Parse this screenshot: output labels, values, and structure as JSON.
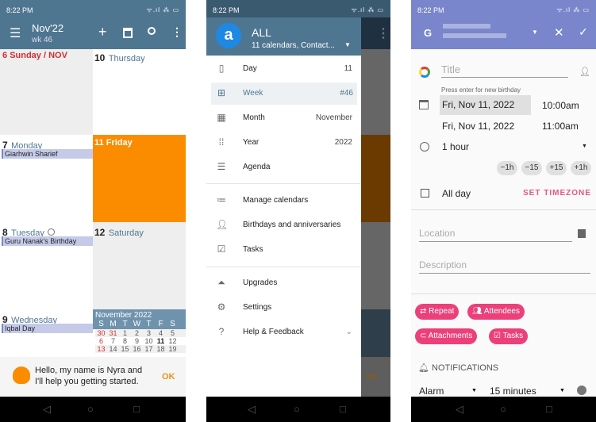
{
  "status": {
    "time": "8:22 PM",
    "icons": "wifi signal battery 38"
  },
  "screen1": {
    "toolbar": {
      "title": "Nov'22",
      "subtitle": "wk 46",
      "menu_icon": "☰",
      "add_icon": "+",
      "today_icon": "calendar-icon",
      "search_icon": "search-icon",
      "more_icon": "⋮"
    },
    "days": [
      {
        "num": "6",
        "name": "Sunday / NOV",
        "events": []
      },
      {
        "num": "7",
        "name": "Monday",
        "events": [
          "Giarhwin Sharief"
        ]
      },
      {
        "num": "8",
        "name": "Tuesday",
        "events": [
          "Guru Nanak's Birthday"
        ]
      },
      {
        "num": "9",
        "name": "Wednesday",
        "events": [
          "Iqbal Day"
        ]
      },
      {
        "num": "10",
        "name": "Thursday",
        "events": []
      },
      {
        "num": "11",
        "name": "Friday",
        "events": []
      },
      {
        "num": "12",
        "name": "Saturday",
        "events": []
      }
    ],
    "mini_calendar": {
      "title": "November 2022",
      "weekdays": [
        "S",
        "M",
        "T",
        "W",
        "T",
        "F",
        "S"
      ],
      "rows": [
        [
          "30",
          "31",
          "1",
          "2",
          "3",
          "4",
          "5"
        ],
        [
          "6",
          "7",
          "8",
          "9",
          "10",
          "11",
          "12"
        ],
        [
          "13",
          "14",
          "15",
          "16",
          "17",
          "18",
          "19"
        ]
      ]
    },
    "assistant": {
      "message": "Hello, my name is Nyra and I'll help you getting started.",
      "ok": "OK"
    },
    "colors": {
      "toolbar": "#4f7690",
      "today": "#fb8c00"
    }
  },
  "screen2": {
    "header": {
      "title": "ALL",
      "subtitle": "11 calendars, Contact...",
      "logo": "a"
    },
    "views": [
      {
        "label": "Day",
        "value": "11"
      },
      {
        "label": "Week",
        "value": "#46"
      },
      {
        "label": "Month",
        "value": "November"
      },
      {
        "label": "Year",
        "value": "2022"
      },
      {
        "label": "Agenda",
        "value": ""
      }
    ],
    "tools": [
      {
        "label": "Manage calendars"
      },
      {
        "label": "Birthdays and anniversaries"
      },
      {
        "label": "Tasks"
      }
    ],
    "other": [
      {
        "label": "Upgrades"
      },
      {
        "label": "Settings"
      },
      {
        "label": "Help & Feedback"
      }
    ],
    "behind_ok": "OK"
  },
  "screen3": {
    "account_icon": "G",
    "title_placeholder": "Title",
    "hint": "Press enter for new birthday",
    "start_date": "Fri, Nov 11, 2022",
    "start_time": "10:00am",
    "end_date": "Fri, Nov 11, 2022",
    "end_time": "11:00am",
    "duration": "1 hour",
    "quick": [
      "−1h",
      "−15",
      "+15",
      "+1h"
    ],
    "all_day": "All day",
    "all_day_checked": false,
    "set_timezone": "SET TIMEZONE",
    "location_placeholder": "Location",
    "description_placeholder": "Description",
    "chips": [
      "Repeat",
      "Attendees",
      "Attachments",
      "Tasks"
    ],
    "notifications": "NOTIFICATIONS",
    "alarm_type": "Alarm",
    "alarm_time": "15 minutes",
    "colors": {
      "header": "#7986cb",
      "accent": "#ec407a"
    }
  }
}
